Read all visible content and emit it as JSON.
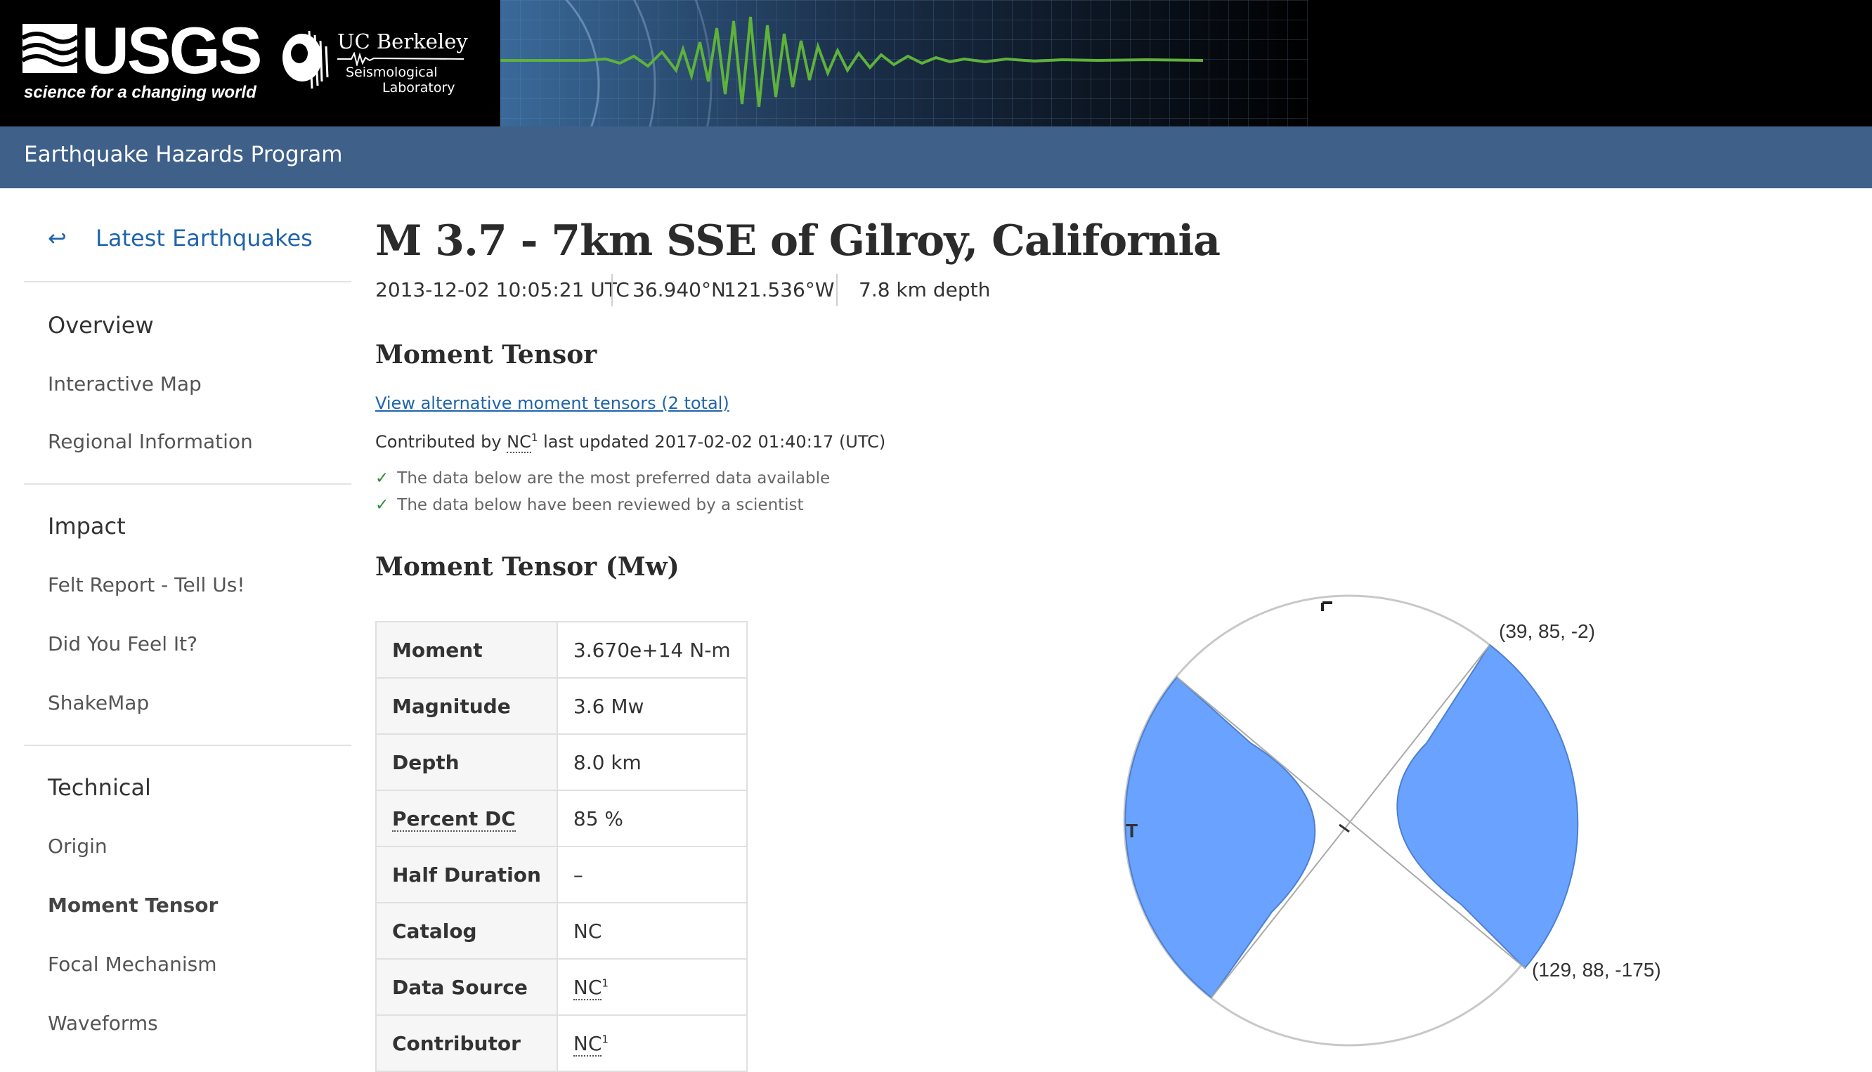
{
  "header": {
    "usgs_wordmark": "USGS",
    "usgs_tagline": "science for a changing world",
    "berkeley_title": "UC Berkeley",
    "berkeley_sub1": "Seismological",
    "berkeley_sub2": "Laboratory",
    "program": "Earthquake Hazards Program"
  },
  "sidebar": {
    "back_arrow_icon": "return-arrow-icon",
    "back_label": "Latest Earthquakes",
    "sections": [
      {
        "heading": "Overview",
        "items": [
          "Interactive Map",
          "Regional Information"
        ]
      },
      {
        "heading": "Impact",
        "items": [
          "Felt Report - Tell Us!",
          "Did You Feel It?",
          "ShakeMap"
        ]
      },
      {
        "heading": "Technical",
        "items": [
          "Origin",
          "Moment Tensor",
          "Focal Mechanism",
          "Waveforms"
        ]
      }
    ],
    "active_item": "Moment Tensor"
  },
  "event": {
    "title": "M 3.7 - 7km SSE of Gilroy, California",
    "time": "2013-12-02 10:05:21 UTC",
    "latitude": "36.940°N",
    "longitude": "121.536°W",
    "depth": "7.8 km depth"
  },
  "moment_tensor": {
    "section_title": "Moment Tensor",
    "alt_link": "View alternative moment tensors (2 total)",
    "contrib_prefix": "Contributed by",
    "contrib_network": "NC",
    "contrib_sup": "1",
    "contrib_suffix": "last updated 2017-02-02 01:40:17 (UTC)",
    "checks": [
      "The data below are the most preferred data available",
      "The data below have been reviewed by a scientist"
    ],
    "table_title": "Moment Tensor (Mw)",
    "rows": [
      {
        "key": "Moment",
        "value": "3.670e+14 N-m"
      },
      {
        "key": "Magnitude",
        "value": "3.6 Mw"
      },
      {
        "key": "Depth",
        "value": "8.0 km"
      },
      {
        "key": "Percent DC",
        "value": "85 %"
      },
      {
        "key": "Half Duration",
        "value": "–"
      },
      {
        "key": "Catalog",
        "value": "NC"
      },
      {
        "key": "Data Source",
        "value": "NC",
        "sup": "1"
      },
      {
        "key": "Contributor",
        "value": "NC",
        "sup": "1"
      }
    ],
    "beachball": {
      "nodal_plane_1": "(39, 85, -2)",
      "nodal_plane_2": "(129, 88, -175)",
      "t_axis_label": "T",
      "p_axis_label": "P",
      "compression_color": "#6aa3ff",
      "outline_color": "#c8c8c8"
    }
  },
  "colors": {
    "header_bg": "#000000",
    "program_bar": "#3e6089",
    "link": "#1f64ad",
    "wave": "#5fb23a"
  }
}
